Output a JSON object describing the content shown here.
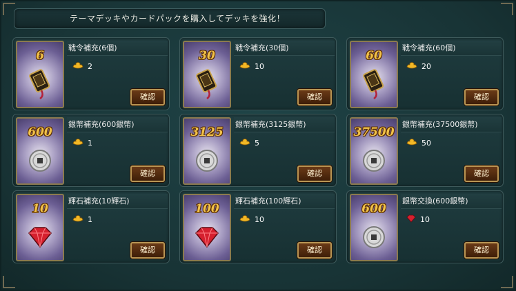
{
  "banner": {
    "text": "テーマデッキやカードパックを購入してデッキを強化！"
  },
  "button_label": "確認",
  "currency_icons": {
    "gold": "gold-ingot-icon",
    "gem": "red-gem-icon"
  },
  "items": [
    {
      "qty": "6",
      "art": "token",
      "title": "戦令補充(6個)",
      "currency": "gold",
      "price": "2"
    },
    {
      "qty": "30",
      "art": "token",
      "title": "戦令補充(30個)",
      "currency": "gold",
      "price": "10"
    },
    {
      "qty": "60",
      "art": "token",
      "title": "戦令補充(60個)",
      "currency": "gold",
      "price": "20"
    },
    {
      "qty": "600",
      "art": "coin",
      "title": "銀幣補充(600銀幣)",
      "currency": "gold",
      "price": "1"
    },
    {
      "qty": "3125",
      "art": "coin",
      "title": "銀幣補充(3125銀幣)",
      "currency": "gold",
      "price": "5"
    },
    {
      "qty": "37500",
      "art": "coin",
      "title": "銀幣補充(37500銀幣)",
      "currency": "gold",
      "price": "50"
    },
    {
      "qty": "10",
      "art": "gem",
      "title": "輝石補充(10輝石)",
      "currency": "gold",
      "price": "1"
    },
    {
      "qty": "100",
      "art": "gem",
      "title": "輝石補充(100輝石)",
      "currency": "gold",
      "price": "10"
    },
    {
      "qty": "600",
      "art": "coin",
      "title": "銀幣交換(600銀幣)",
      "currency": "gem",
      "price": "10"
    }
  ]
}
